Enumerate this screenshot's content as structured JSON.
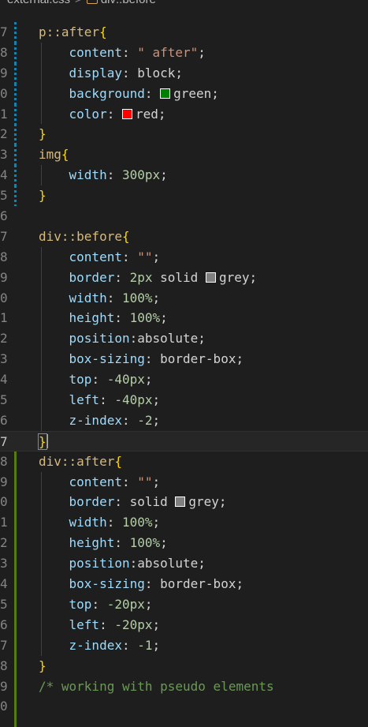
{
  "breadcrumb": {
    "file": "external.css",
    "separator": ">",
    "symbol": "div::before",
    "file_icon": "css-file-icon",
    "symbol_icon": "selector-icon"
  },
  "lines": [
    {
      "num": "7",
      "mark": "mod",
      "indent": 0,
      "tokens": [
        {
          "t": "sel",
          "v": "p::after"
        },
        {
          "t": "brace",
          "v": "{"
        }
      ]
    },
    {
      "num": "8",
      "mark": "mod",
      "indent": 1,
      "tokens": [
        {
          "t": "prop",
          "v": "content"
        },
        {
          "t": "punc",
          "v": ": "
        },
        {
          "t": "str",
          "v": "\" after\""
        },
        {
          "t": "punc",
          "v": ";"
        }
      ]
    },
    {
      "num": "9",
      "mark": "mod",
      "indent": 1,
      "tokens": [
        {
          "t": "prop",
          "v": "display"
        },
        {
          "t": "punc",
          "v": ": block;"
        }
      ]
    },
    {
      "num": "0",
      "mark": "mod",
      "indent": 1,
      "tokens": [
        {
          "t": "prop",
          "v": "background"
        },
        {
          "t": "punc",
          "v": ": "
        },
        {
          "t": "swatch",
          "v": "#008000"
        },
        {
          "t": "punc",
          "v": "green;"
        }
      ]
    },
    {
      "num": "1",
      "mark": "mod",
      "indent": 1,
      "tokens": [
        {
          "t": "prop",
          "v": "color"
        },
        {
          "t": "punc",
          "v": ": "
        },
        {
          "t": "swatch",
          "v": "#ff0000"
        },
        {
          "t": "punc",
          "v": "red;"
        }
      ]
    },
    {
      "num": "2",
      "mark": "mod",
      "indent": 0,
      "tokens": [
        {
          "t": "brace",
          "v": "}"
        }
      ]
    },
    {
      "num": "3",
      "mark": "mod",
      "indent": 0,
      "tokens": [
        {
          "t": "sel",
          "v": "img"
        },
        {
          "t": "brace",
          "v": "{"
        }
      ]
    },
    {
      "num": "4",
      "mark": "mod",
      "indent": 1,
      "tokens": [
        {
          "t": "prop",
          "v": "width"
        },
        {
          "t": "punc",
          "v": ": "
        },
        {
          "t": "num",
          "v": "300px"
        },
        {
          "t": "punc",
          "v": ";"
        }
      ]
    },
    {
      "num": "5",
      "mark": "mod",
      "indent": 0,
      "tokens": [
        {
          "t": "brace",
          "v": "}"
        }
      ]
    },
    {
      "num": "6",
      "mark": "",
      "indent": 0,
      "tokens": []
    },
    {
      "num": "7",
      "mark": "",
      "indent": 0,
      "tokens": [
        {
          "t": "sel",
          "v": "div::before"
        },
        {
          "t": "brace",
          "v": "{"
        }
      ]
    },
    {
      "num": "8",
      "mark": "",
      "indent": 1,
      "tokens": [
        {
          "t": "prop",
          "v": "content"
        },
        {
          "t": "punc",
          "v": ": "
        },
        {
          "t": "str",
          "v": "\"\""
        },
        {
          "t": "punc",
          "v": ";"
        }
      ]
    },
    {
      "num": "9",
      "mark": "",
      "indent": 1,
      "tokens": [
        {
          "t": "prop",
          "v": "border"
        },
        {
          "t": "punc",
          "v": ": "
        },
        {
          "t": "num",
          "v": "2px"
        },
        {
          "t": "punc",
          "v": " solid "
        },
        {
          "t": "swatch",
          "v": "#808080"
        },
        {
          "t": "punc",
          "v": "grey;"
        }
      ]
    },
    {
      "num": "0",
      "mark": "",
      "indent": 1,
      "tokens": [
        {
          "t": "prop",
          "v": "width"
        },
        {
          "t": "punc",
          "v": ": "
        },
        {
          "t": "num",
          "v": "100%"
        },
        {
          "t": "punc",
          "v": ";"
        }
      ]
    },
    {
      "num": "1",
      "mark": "",
      "indent": 1,
      "tokens": [
        {
          "t": "prop",
          "v": "height"
        },
        {
          "t": "punc",
          "v": ": "
        },
        {
          "t": "num",
          "v": "100%"
        },
        {
          "t": "punc",
          "v": ";"
        }
      ]
    },
    {
      "num": "2",
      "mark": "",
      "indent": 1,
      "tokens": [
        {
          "t": "prop",
          "v": "position"
        },
        {
          "t": "punc",
          "v": ":absolute;"
        }
      ]
    },
    {
      "num": "3",
      "mark": "",
      "indent": 1,
      "tokens": [
        {
          "t": "prop",
          "v": "box-sizing"
        },
        {
          "t": "punc",
          "v": ": border-box;"
        }
      ]
    },
    {
      "num": "4",
      "mark": "",
      "indent": 1,
      "tokens": [
        {
          "t": "prop",
          "v": "top"
        },
        {
          "t": "punc",
          "v": ": "
        },
        {
          "t": "num",
          "v": "-40px"
        },
        {
          "t": "punc",
          "v": ";"
        }
      ]
    },
    {
      "num": "5",
      "mark": "",
      "indent": 1,
      "tokens": [
        {
          "t": "prop",
          "v": "left"
        },
        {
          "t": "punc",
          "v": ": "
        },
        {
          "t": "num",
          "v": "-40px"
        },
        {
          "t": "punc",
          "v": ";"
        }
      ]
    },
    {
      "num": "6",
      "mark": "",
      "indent": 1,
      "tokens": [
        {
          "t": "prop",
          "v": "z-index"
        },
        {
          "t": "punc",
          "v": ": "
        },
        {
          "t": "num",
          "v": "-2"
        },
        {
          "t": "punc",
          "v": ";"
        }
      ]
    },
    {
      "num": "7",
      "mark": "",
      "indent": 0,
      "active": true,
      "tokens": [
        {
          "t": "brace-box",
          "v": "}"
        },
        {
          "t": "cursor",
          "v": ""
        }
      ]
    },
    {
      "num": "8",
      "mark": "add",
      "indent": 0,
      "tokens": [
        {
          "t": "sel",
          "v": "div::after"
        },
        {
          "t": "brace",
          "v": "{"
        }
      ]
    },
    {
      "num": "9",
      "mark": "add",
      "indent": 1,
      "tokens": [
        {
          "t": "prop",
          "v": "content"
        },
        {
          "t": "punc",
          "v": ": "
        },
        {
          "t": "str",
          "v": "\"\""
        },
        {
          "t": "punc",
          "v": ";"
        }
      ]
    },
    {
      "num": "0",
      "mark": "add",
      "indent": 1,
      "tokens": [
        {
          "t": "prop",
          "v": "border"
        },
        {
          "t": "punc",
          "v": ": solid "
        },
        {
          "t": "swatch",
          "v": "#808080"
        },
        {
          "t": "punc",
          "v": "grey;"
        }
      ]
    },
    {
      "num": "1",
      "mark": "add",
      "indent": 1,
      "tokens": [
        {
          "t": "prop",
          "v": "width"
        },
        {
          "t": "punc",
          "v": ": "
        },
        {
          "t": "num",
          "v": "100%"
        },
        {
          "t": "punc",
          "v": ";"
        }
      ]
    },
    {
      "num": "2",
      "mark": "add",
      "indent": 1,
      "tokens": [
        {
          "t": "prop",
          "v": "height"
        },
        {
          "t": "punc",
          "v": ": "
        },
        {
          "t": "num",
          "v": "100%"
        },
        {
          "t": "punc",
          "v": ";"
        }
      ]
    },
    {
      "num": "3",
      "mark": "add",
      "indent": 1,
      "tokens": [
        {
          "t": "prop",
          "v": "position"
        },
        {
          "t": "punc",
          "v": ":absolute;"
        }
      ]
    },
    {
      "num": "4",
      "mark": "add",
      "indent": 1,
      "tokens": [
        {
          "t": "prop",
          "v": "box-sizing"
        },
        {
          "t": "punc",
          "v": ": border-box;"
        }
      ]
    },
    {
      "num": "5",
      "mark": "add",
      "indent": 1,
      "tokens": [
        {
          "t": "prop",
          "v": "top"
        },
        {
          "t": "punc",
          "v": ": "
        },
        {
          "t": "num",
          "v": "-20px"
        },
        {
          "t": "punc",
          "v": ";"
        }
      ]
    },
    {
      "num": "6",
      "mark": "add",
      "indent": 1,
      "tokens": [
        {
          "t": "prop",
          "v": "left"
        },
        {
          "t": "punc",
          "v": ": "
        },
        {
          "t": "num",
          "v": "-20px"
        },
        {
          "t": "punc",
          "v": ";"
        }
      ]
    },
    {
      "num": "7",
      "mark": "add",
      "indent": 1,
      "tokens": [
        {
          "t": "prop",
          "v": "z-index"
        },
        {
          "t": "punc",
          "v": ": "
        },
        {
          "t": "num",
          "v": "-1"
        },
        {
          "t": "punc",
          "v": ";"
        }
      ]
    },
    {
      "num": "8",
      "mark": "add",
      "indent": 0,
      "tokens": [
        {
          "t": "brace",
          "v": "}"
        }
      ]
    },
    {
      "num": "9",
      "mark": "add",
      "indent": 0,
      "tokens": [
        {
          "t": "cmt",
          "v": "/* working with pseudo elements"
        }
      ]
    },
    {
      "num": "0",
      "mark": "add",
      "indent": 0,
      "tokens": []
    },
    {
      "num": "",
      "mark": "add",
      "indent": 0,
      "tokens": []
    }
  ]
}
